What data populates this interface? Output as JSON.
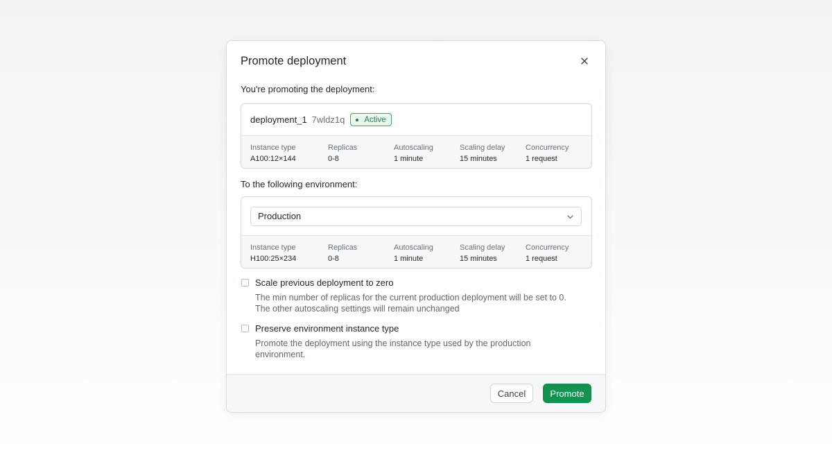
{
  "dialog": {
    "title": "Promote deployment",
    "close_icon": "close-icon"
  },
  "source": {
    "label": "You're promoting the deployment:",
    "name": "deployment_1",
    "id": "7wldz1q",
    "status": "Active",
    "status_color": "#1c7f47",
    "specs": [
      {
        "label": "Instance type",
        "value": "A100:12×144"
      },
      {
        "label": "Replicas",
        "value": "0-8"
      },
      {
        "label": "Autoscaling",
        "value": "1 minute"
      },
      {
        "label": "Scaling delay",
        "value": "15 minutes"
      },
      {
        "label": "Concurrency",
        "value": "1 request"
      }
    ]
  },
  "target": {
    "label": "To the following environment:",
    "environment": "Production",
    "chevron_icon": "chevron-down-icon",
    "specs": [
      {
        "label": "Instance type",
        "value": "H100:25×234"
      },
      {
        "label": "Replicas",
        "value": "0-8"
      },
      {
        "label": "Autoscaling",
        "value": "1 minute"
      },
      {
        "label": "Scaling delay",
        "value": "15 minutes"
      },
      {
        "label": "Concurrency",
        "value": "1 request"
      }
    ]
  },
  "options": [
    {
      "title": "Scale previous deployment to zero",
      "description_line1": "The min number of replicas for the current production deployment will be set to 0.",
      "description_line2": "The other autoscaling settings will remain unchanged",
      "checked": false
    },
    {
      "title": "Preserve environment instance type",
      "description_line1": "Promote the deployment using the instance type used by the production",
      "description_line2": "environment.",
      "checked": false
    }
  ],
  "footer": {
    "cancel_label": "Cancel",
    "promote_label": "Promote",
    "accent_color": "#15924f"
  }
}
